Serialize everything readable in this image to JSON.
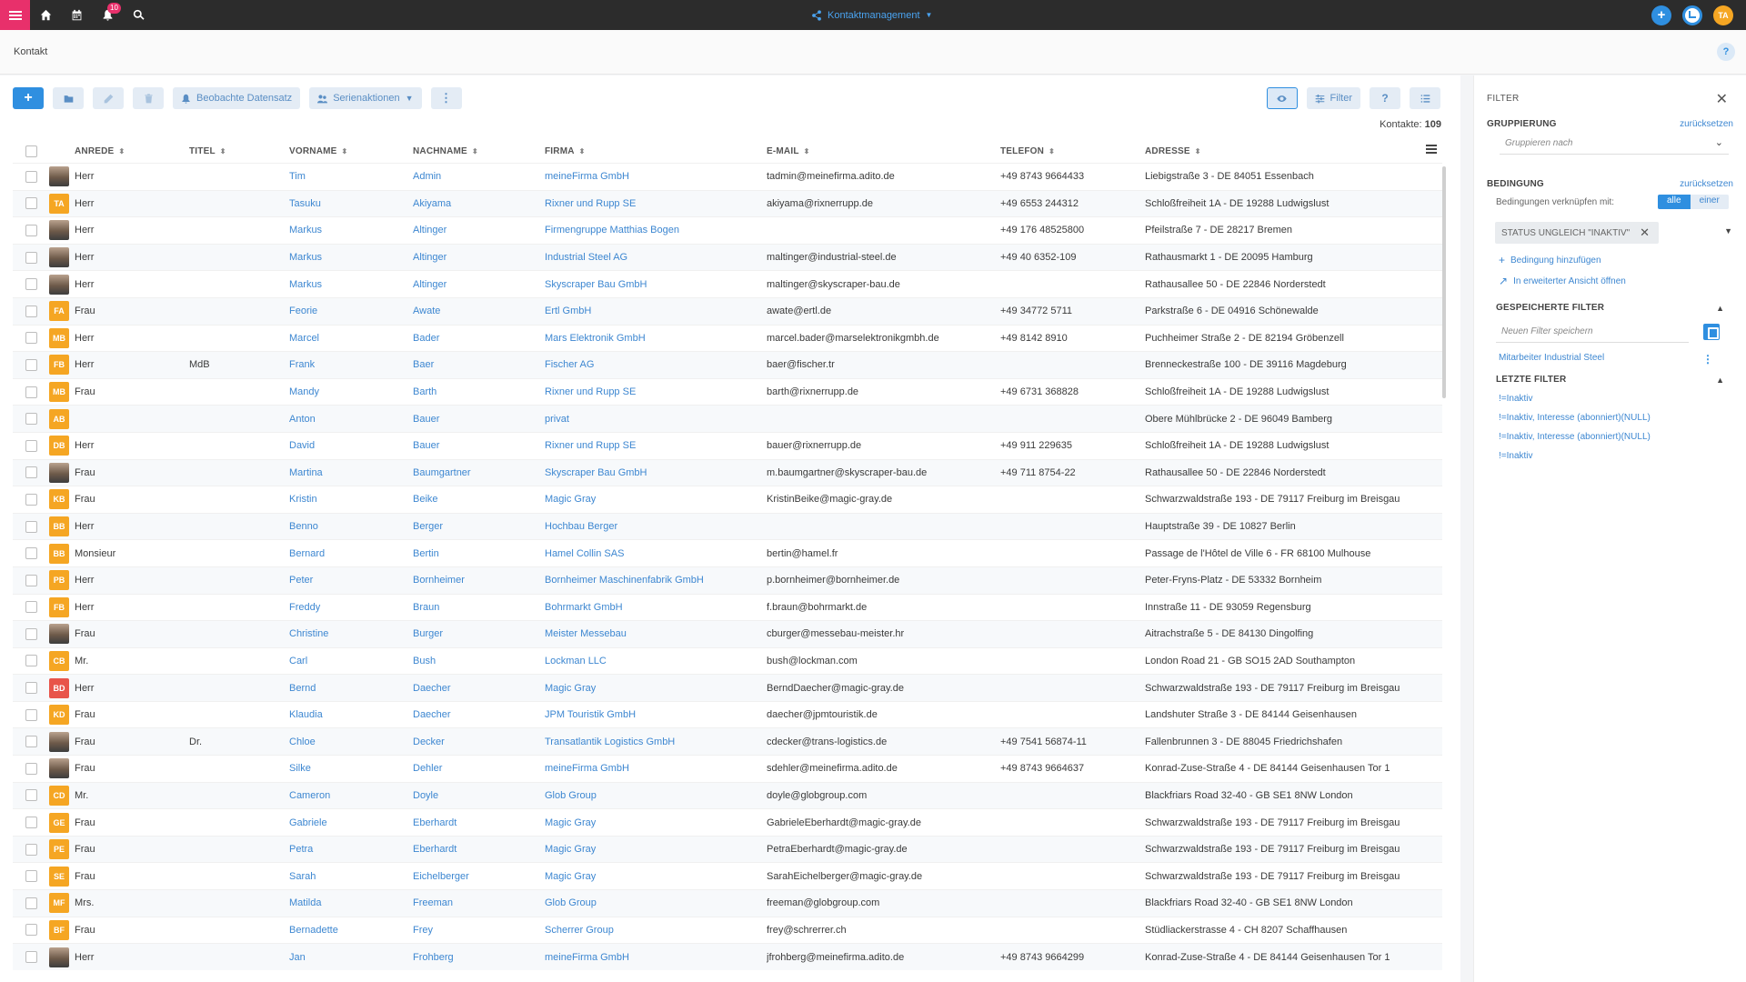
{
  "topbar": {
    "notification_count": "10",
    "app_name": "Kontaktmanagement",
    "user_initials": "TA"
  },
  "breadcrumb": {
    "title": "Kontakt",
    "help": "?"
  },
  "toolbar": {
    "add": "+",
    "watch_label": "Beobachte Datensatz",
    "serial_label": "Serienaktionen",
    "filter_label": "Filter",
    "help": "?"
  },
  "count": {
    "label": "Kontakte:",
    "value": "109"
  },
  "columns": {
    "anrede": "ANREDE",
    "titel": "TITEL",
    "vorname": "VORNAME",
    "nachname": "NACHNAME",
    "firma": "FIRMA",
    "email": "E-MAIL",
    "telefon": "TELEFON",
    "adresse": "ADRESSE"
  },
  "rows": [
    {
      "av": "photo",
      "ini": "",
      "color": "",
      "anrede": "Herr",
      "titel": "",
      "vorname": "Tim",
      "nachname": "Admin",
      "firma": "meineFirma GmbH",
      "email": "tadmin@meinefirma.adito.de",
      "telefon": "+49 8743 9664433",
      "adresse": "Liebigstraße 3 - DE 84051 Essenbach"
    },
    {
      "av": "init",
      "ini": "TA",
      "color": "#f5a623",
      "anrede": "Herr",
      "titel": "",
      "vorname": "Tasuku",
      "nachname": "Akiyama",
      "firma": "Rixner und Rupp SE",
      "email": "akiyama@rixnerrupp.de",
      "telefon": "+49 6553 244312",
      "adresse": "Schloßfreiheit 1A - DE 19288 Ludwigslust"
    },
    {
      "av": "photo",
      "ini": "",
      "color": "",
      "anrede": "Herr",
      "titel": "",
      "vorname": "Markus",
      "nachname": "Altinger",
      "firma": "Firmengruppe Matthias Bogen",
      "email": "",
      "telefon": "+49 176 48525800",
      "adresse": "Pfeilstraße 7 - DE 28217 Bremen"
    },
    {
      "av": "photo",
      "ini": "",
      "color": "",
      "anrede": "Herr",
      "titel": "",
      "vorname": "Markus",
      "nachname": "Altinger",
      "firma": "Industrial Steel AG",
      "email": "maltinger@industrial-steel.de",
      "telefon": "+49 40 6352-109",
      "adresse": "Rathausmarkt 1 - DE 20095 Hamburg"
    },
    {
      "av": "photo",
      "ini": "",
      "color": "",
      "anrede": "Herr",
      "titel": "",
      "vorname": "Markus",
      "nachname": "Altinger",
      "firma": "Skyscraper Bau GmbH",
      "email": "maltinger@skyscraper-bau.de",
      "telefon": "",
      "adresse": "Rathausallee 50 - DE 22846 Norderstedt"
    },
    {
      "av": "init",
      "ini": "FA",
      "color": "#f5a623",
      "anrede": "Frau",
      "titel": "",
      "vorname": "Feorie",
      "nachname": "Awate",
      "firma": "Ertl GmbH",
      "email": "awate@ertl.de",
      "telefon": "+49 34772 5711",
      "adresse": "Parkstraße 6 - DE 04916 Schönewalde"
    },
    {
      "av": "init",
      "ini": "MB",
      "color": "#f5a623",
      "anrede": "Herr",
      "titel": "",
      "vorname": "Marcel",
      "nachname": "Bader",
      "firma": "Mars Elektronik GmbH",
      "email": "marcel.bader@marselektronikgmbh.de",
      "telefon": "+49 8142 8910",
      "adresse": "Puchheimer Straße 2 - DE 82194 Gröbenzell"
    },
    {
      "av": "init",
      "ini": "FB",
      "color": "#f5a623",
      "anrede": "Herr",
      "titel": "MdB",
      "vorname": "Frank",
      "nachname": "Baer",
      "firma": "Fischer AG",
      "email": "baer@fischer.tr",
      "telefon": "",
      "adresse": "Brenneckestraße 100 - DE 39116 Magdeburg"
    },
    {
      "av": "init",
      "ini": "MB",
      "color": "#f5a623",
      "anrede": "Frau",
      "titel": "",
      "vorname": "Mandy",
      "nachname": "Barth",
      "firma": "Rixner und Rupp SE",
      "email": "barth@rixnerrupp.de",
      "telefon": "+49 6731 368828",
      "adresse": "Schloßfreiheit 1A - DE 19288 Ludwigslust"
    },
    {
      "av": "init",
      "ini": "AB",
      "color": "#f5a623",
      "anrede": "",
      "titel": "",
      "vorname": "Anton",
      "nachname": "Bauer",
      "firma": "privat",
      "email": "",
      "telefon": "",
      "adresse": "Obere Mühlbrücke 2 - DE 96049 Bamberg"
    },
    {
      "av": "init",
      "ini": "DB",
      "color": "#f5a623",
      "anrede": "Herr",
      "titel": "",
      "vorname": "David",
      "nachname": "Bauer",
      "firma": "Rixner und Rupp SE",
      "email": "bauer@rixnerrupp.de",
      "telefon": "+49 911 229635",
      "adresse": "Schloßfreiheit 1A - DE 19288 Ludwigslust"
    },
    {
      "av": "photo",
      "ini": "",
      "color": "",
      "anrede": "Frau",
      "titel": "",
      "vorname": "Martina",
      "nachname": "Baumgartner",
      "firma": "Skyscraper Bau GmbH",
      "email": "m.baumgartner@skyscraper-bau.de",
      "telefon": "+49 711 8754-22",
      "adresse": "Rathausallee 50 - DE 22846 Norderstedt"
    },
    {
      "av": "init",
      "ini": "KB",
      "color": "#f5a623",
      "anrede": "Frau",
      "titel": "",
      "vorname": "Kristin",
      "nachname": "Beike",
      "firma": "Magic Gray",
      "email": "KristinBeike@magic-gray.de",
      "telefon": "",
      "adresse": "Schwarzwaldstraße 193 - DE 79117 Freiburg im Breisgau"
    },
    {
      "av": "init",
      "ini": "BB",
      "color": "#f5a623",
      "anrede": "Herr",
      "titel": "",
      "vorname": "Benno",
      "nachname": "Berger",
      "firma": "Hochbau Berger",
      "email": "",
      "telefon": "",
      "adresse": "Hauptstraße 39 - DE 10827 Berlin"
    },
    {
      "av": "init",
      "ini": "BB",
      "color": "#f5a623",
      "anrede": "Monsieur",
      "titel": "",
      "vorname": "Bernard",
      "nachname": "Bertin",
      "firma": "Hamel Collin SAS",
      "email": "bertin@hamel.fr",
      "telefon": "",
      "adresse": "Passage de l'Hôtel de Ville 6 - FR 68100 Mulhouse"
    },
    {
      "av": "init",
      "ini": "PB",
      "color": "#f5a623",
      "anrede": "Herr",
      "titel": "",
      "vorname": "Peter",
      "nachname": "Bornheimer",
      "firma": "Bornheimer Maschinenfabrik GmbH",
      "email": "p.bornheimer@bornheimer.de",
      "telefon": "",
      "adresse": "Peter-Fryns-Platz - DE 53332 Bornheim"
    },
    {
      "av": "init",
      "ini": "FB",
      "color": "#f5a623",
      "anrede": "Herr",
      "titel": "",
      "vorname": "Freddy",
      "nachname": "Braun",
      "firma": "Bohrmarkt GmbH",
      "email": "f.braun@bohrmarkt.de",
      "telefon": "",
      "adresse": "Innstraße 11 - DE 93059 Regensburg"
    },
    {
      "av": "photo",
      "ini": "",
      "color": "",
      "anrede": "Frau",
      "titel": "",
      "vorname": "Christine",
      "nachname": "Burger",
      "firma": "Meister Messebau",
      "email": "cburger@messebau-meister.hr",
      "telefon": "",
      "adresse": "Aitrachstraße 5 - DE 84130 Dingolfing"
    },
    {
      "av": "init",
      "ini": "CB",
      "color": "#f5a623",
      "anrede": "Mr.",
      "titel": "",
      "vorname": "Carl",
      "nachname": "Bush",
      "firma": "Lockman LLC",
      "email": "bush@lockman.com",
      "telefon": "",
      "adresse": "London Road 21 - GB SO15 2AD Southampton"
    },
    {
      "av": "init",
      "ini": "BD",
      "color": "#e8544a",
      "anrede": "Herr",
      "titel": "",
      "vorname": "Bernd",
      "nachname": "Daecher",
      "firma": "Magic Gray",
      "email": "BerndDaecher@magic-gray.de",
      "telefon": "",
      "adresse": "Schwarzwaldstraße 193 - DE 79117 Freiburg im Breisgau"
    },
    {
      "av": "init",
      "ini": "KD",
      "color": "#f5a623",
      "anrede": "Frau",
      "titel": "",
      "vorname": "Klaudia",
      "nachname": "Daecher",
      "firma": "JPM Touristik GmbH",
      "email": "daecher@jpmtouristik.de",
      "telefon": "",
      "adresse": "Landshuter Straße 3 - DE 84144 Geisenhausen"
    },
    {
      "av": "photo",
      "ini": "",
      "color": "",
      "anrede": "Frau",
      "titel": "Dr.",
      "vorname": "Chloe",
      "nachname": "Decker",
      "firma": "Transatlantik Logistics GmbH",
      "email": "cdecker@trans-logistics.de",
      "telefon": "+49 7541 56874-11",
      "adresse": "Fallenbrunnen 3 - DE 88045 Friedrichshafen"
    },
    {
      "av": "photo",
      "ini": "",
      "color": "",
      "anrede": "Frau",
      "titel": "",
      "vorname": "Silke",
      "nachname": "Dehler",
      "firma": "meineFirma GmbH",
      "email": "sdehler@meinefirma.adito.de",
      "telefon": "+49 8743 9664637",
      "adresse": "Konrad-Zuse-Straße 4 - DE 84144 Geisenhausen Tor 1"
    },
    {
      "av": "init",
      "ini": "CD",
      "color": "#f5a623",
      "anrede": "Mr.",
      "titel": "",
      "vorname": "Cameron",
      "nachname": "Doyle",
      "firma": "Glob Group",
      "email": "doyle@globgroup.com",
      "telefon": "",
      "adresse": "Blackfriars Road 32-40 - GB SE1 8NW London"
    },
    {
      "av": "init",
      "ini": "GE",
      "color": "#f5a623",
      "anrede": "Frau",
      "titel": "",
      "vorname": "Gabriele",
      "nachname": "Eberhardt",
      "firma": "Magic Gray",
      "email": "GabrieleEberhardt@magic-gray.de",
      "telefon": "",
      "adresse": "Schwarzwaldstraße 193 - DE 79117 Freiburg im Breisgau"
    },
    {
      "av": "init",
      "ini": "PE",
      "color": "#f5a623",
      "anrede": "Frau",
      "titel": "",
      "vorname": "Petra",
      "nachname": "Eberhardt",
      "firma": "Magic Gray",
      "email": "PetraEberhardt@magic-gray.de",
      "telefon": "",
      "adresse": "Schwarzwaldstraße 193 - DE 79117 Freiburg im Breisgau"
    },
    {
      "av": "init",
      "ini": "SE",
      "color": "#f5a623",
      "anrede": "Frau",
      "titel": "",
      "vorname": "Sarah",
      "nachname": "Eichelberger",
      "firma": "Magic Gray",
      "email": "SarahEichelberger@magic-gray.de",
      "telefon": "",
      "adresse": "Schwarzwaldstraße 193 - DE 79117 Freiburg im Breisgau"
    },
    {
      "av": "init",
      "ini": "MF",
      "color": "#f5a623",
      "anrede": "Mrs.",
      "titel": "",
      "vorname": "Matilda",
      "nachname": "Freeman",
      "firma": "Glob Group",
      "email": "freeman@globgroup.com",
      "telefon": "",
      "adresse": "Blackfriars Road 32-40 - GB SE1 8NW London"
    },
    {
      "av": "init",
      "ini": "BF",
      "color": "#f5a623",
      "anrede": "Frau",
      "titel": "",
      "vorname": "Bernadette",
      "nachname": "Frey",
      "firma": "Scherrer Group",
      "email": "frey@schrerrer.ch",
      "telefon": "",
      "adresse": "Stüdliackerstrasse 4 - CH 8207 Schaffhausen"
    },
    {
      "av": "photo",
      "ini": "",
      "color": "",
      "anrede": "Herr",
      "titel": "",
      "vorname": "Jan",
      "nachname": "Frohberg",
      "firma": "meineFirma GmbH",
      "email": "jfrohberg@meinefirma.adito.de",
      "telefon": "+49 8743 9664299",
      "adresse": "Konrad-Zuse-Straße 4 - DE 84144 Geisenhausen Tor 1"
    }
  ],
  "filter": {
    "title": "FILTER",
    "grouping_label": "GRUPPIERUNG",
    "grouping_reset": "zurücksetzen",
    "grouping_placeholder": "Gruppieren nach",
    "condition_label": "BEDINGUNG",
    "condition_reset": "zurücksetzen",
    "combine_label": "Bedingungen verknüpfen mit:",
    "combine_all": "alle",
    "combine_one": "einer",
    "condition_chip": "STATUS UNGLEICH \"INAKTIV\"",
    "add_condition": "Bedingung hinzufügen",
    "open_advanced": "In erweiterter Ansicht öffnen",
    "saved_label": "GESPEICHERTE FILTER",
    "save_placeholder": "Neuen Filter speichern",
    "saved_items": [
      "Mitarbeiter Industrial Steel"
    ],
    "recent_label": "LETZTE FILTER",
    "recent_items": [
      "!=Inaktiv",
      "!=Inaktiv, Interesse (abonniert)(NULL)",
      "!=Inaktiv, Interesse (abonniert)(NULL)",
      "!=Inaktiv"
    ]
  },
  "colors": {
    "accent": "#2f8fe0",
    "brand": "#e8306b",
    "avatar_orange": "#f5a623",
    "avatar_red": "#e8544a",
    "link": "#3d87d1"
  }
}
